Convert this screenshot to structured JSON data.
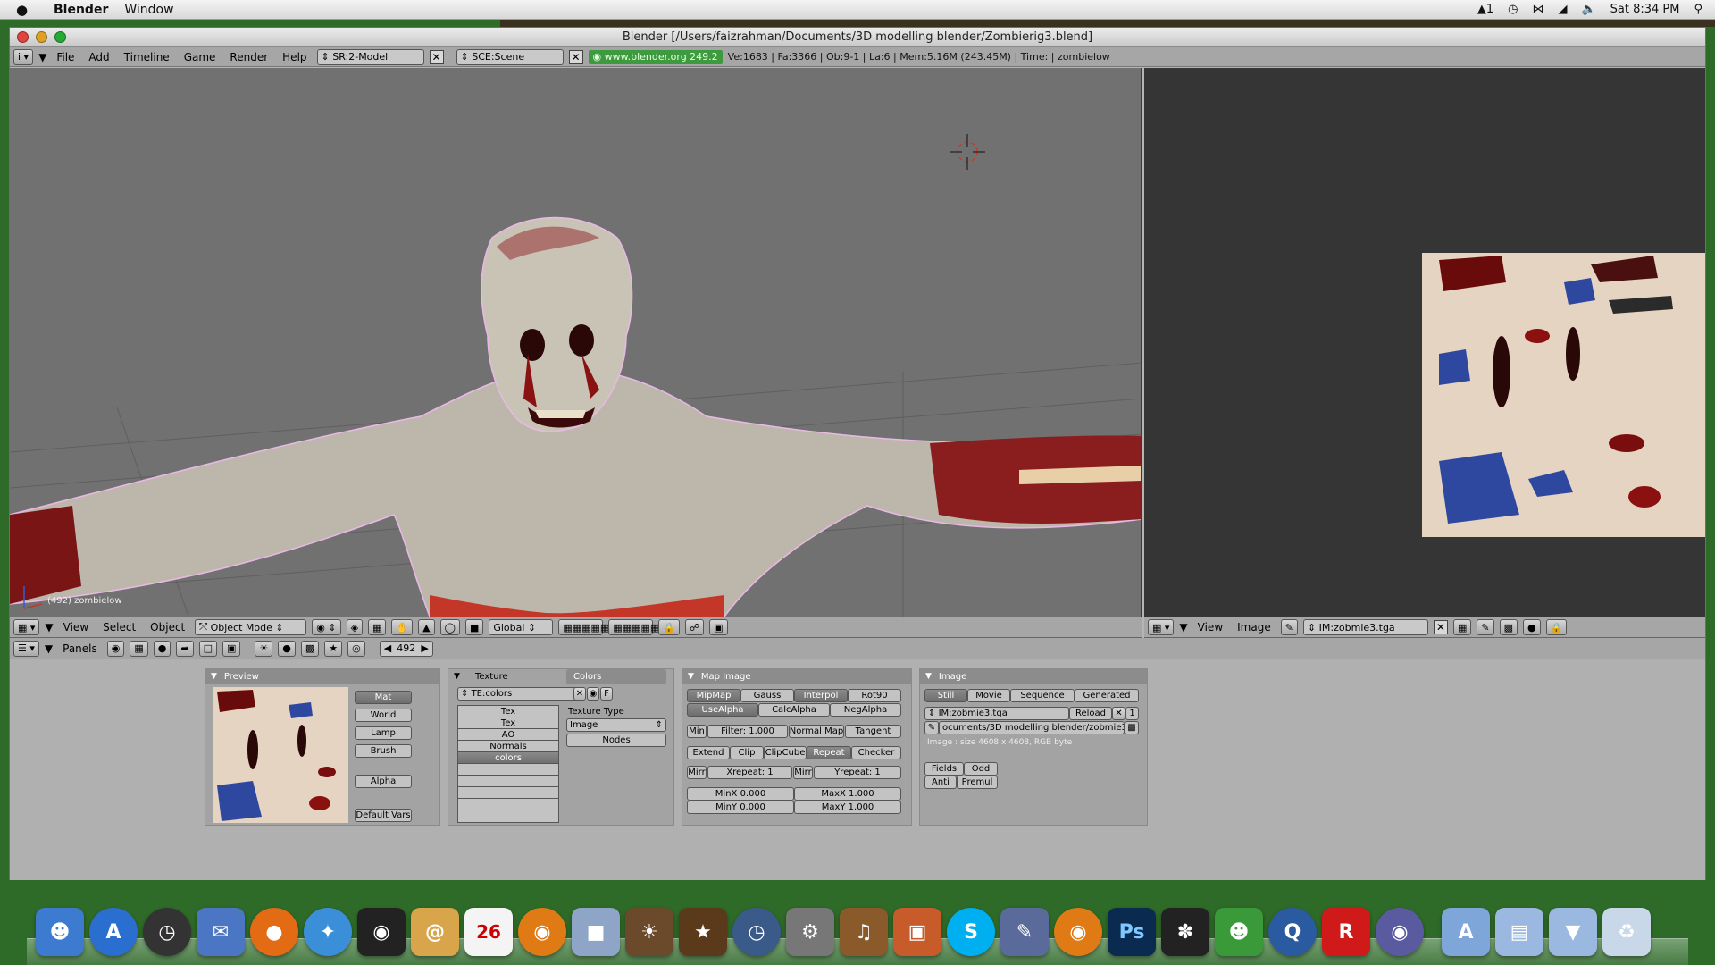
{
  "menubar": {
    "apple": "",
    "app": "Blender",
    "window": "Window",
    "battery": "1",
    "clock": "Sat 8:34 PM"
  },
  "window": {
    "title": "Blender [/Users/faizrahman/Documents/3D modelling blender/Zombierig3.blend]"
  },
  "header": {
    "info": "i",
    "menus": [
      "File",
      "Add",
      "Timeline",
      "Game",
      "Render",
      "Help"
    ],
    "screen": "SR:2-Model",
    "scene": "SCE:Scene",
    "link": "www.blender.org 249.2",
    "stats": "Ve:1683 | Fa:3366 | Ob:9-1 | La:6  | Mem:5.16M (243.45M)  | Time:  | zombielow"
  },
  "viewport": {
    "label": "(492) zombielow",
    "menus": [
      "View",
      "Select",
      "Object"
    ],
    "mode": "Object Mode",
    "orientation": "Global"
  },
  "image_editor": {
    "menus": [
      "View",
      "Image"
    ],
    "image": "IM:zobmie3.tga"
  },
  "buttons": {
    "panels_label": "Panels",
    "frame": "492",
    "preview": {
      "title": "Preview",
      "mat": "Mat",
      "world": "World",
      "lamp": "Lamp",
      "brush": "Brush",
      "alpha": "Alpha",
      "default_vars": "Default Vars"
    },
    "texture": {
      "tab1": "Texture",
      "tab2": "Colors",
      "te": "TE:colors",
      "f_btn": "F",
      "channels": [
        "Tex",
        "Tex",
        "AO",
        "Normals",
        "colors"
      ],
      "type_label": "Texture Type",
      "type_value": "Image",
      "nodes": "Nodes"
    },
    "map_image": {
      "title": "Map Image",
      "row1": [
        "MipMap",
        "Gauss",
        "Interpol",
        "Rot90"
      ],
      "row2": [
        "UseAlpha",
        "CalcAlpha",
        "NegAlpha"
      ],
      "min": "Min",
      "filter": "Filter: 1.000",
      "normal_map": "Normal Map",
      "tangent": "Tangent",
      "row4": [
        "Extend",
        "Clip",
        "ClipCube",
        "Repeat",
        "Checker"
      ],
      "mirr": "Mirr",
      "xrepeat": "Xrepeat: 1",
      "yrepeat": "Yrepeat: 1",
      "minx": "MinX 0.000",
      "maxx": "MaxX 1.000",
      "miny": "MinY 0.000",
      "maxy": "MaxY 1.000"
    },
    "image": {
      "title": "Image",
      "row1": [
        "Still",
        "Movie",
        "Sequence",
        "Generated"
      ],
      "im": "IM:zobmie3.tga",
      "reload": "Reload",
      "users": "1",
      "path": "ocuments/3D modelling blender/zobmie3.tga",
      "info": "Image : size 4608 x 4608, RGB byte",
      "fields": "Fields",
      "odd": "Odd",
      "anti": "Anti",
      "premul": "Premul"
    }
  },
  "dock": {
    "calendar_day": "26",
    "photoshop": "Ps",
    "roblox": "R"
  },
  "colors": {
    "viewport_bg": "#717171",
    "link_green": "#3e9a3e",
    "texture_bg": "#e6d4c2"
  }
}
